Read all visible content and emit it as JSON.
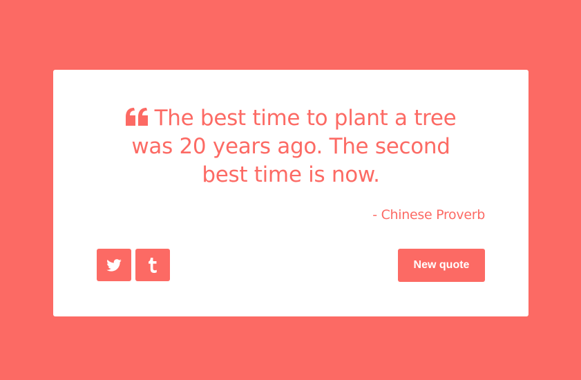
{
  "quote": {
    "text": "The best time to plant a tree was 20 years ago. The second best time is now.",
    "author": "- Chinese Proverb"
  },
  "actions": {
    "new_quote_label": "New quote"
  },
  "icons": {
    "quote": "quote-left-icon",
    "twitter": "twitter-icon",
    "tumblr": "tumblr-icon"
  },
  "colors": {
    "background": "#fc6a64",
    "card": "#ffffff",
    "accent": "#fc6a64"
  }
}
